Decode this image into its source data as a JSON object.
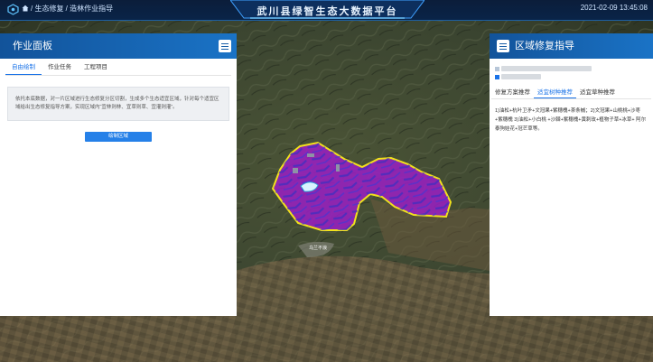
{
  "header": {
    "breadcrumb": "/ 生态修复 / 造林作业指导",
    "title": "武川县绿智生态大数据平台",
    "datetime": "2021-02-09 13:45:08"
  },
  "left_panel": {
    "title": "作业面板",
    "tabs": [
      "自由绘制",
      "作业任务",
      "工程项目"
    ],
    "active_tab": 0,
    "info": "依托本底数据，对一片区域进行生态修复分区切割，生成多个生态适宜区域，针对每个适宜区域给出生态修复指导方案，实现区域内“宜林则林、宜草则草、宜灌则灌”。",
    "button": "绘制区域"
  },
  "right_panel": {
    "title": "区域修复指导",
    "tabs": [
      "修复方案推荐",
      "适宜树种推荐",
      "适宜草种推荐"
    ],
    "active_tab": 1,
    "text": "1)油松+杭叶卫矛+文冠果+紫穗槐+茶条槭；2)文冠果+山桃桃+沙枣+紫穗槐 3)油松+小白桃 +沙棘+紫穗槐+黄刺玫+植物子草+冰草+ 阿尔泰狗娃花+冠芒草等。"
  },
  "map": {
    "place_label": "乌兰不浪"
  },
  "colors": {
    "header_bg": "#0a2448",
    "panel_header": "#1a73c6",
    "accent": "#1a73e8",
    "region_fill": "#9b1fc4",
    "region_outline": "#f2e21c"
  }
}
